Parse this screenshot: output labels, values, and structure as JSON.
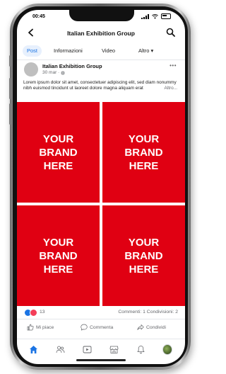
{
  "status_bar": {
    "time": "00:45"
  },
  "header": {
    "title": "Italian Exhibition Group",
    "back_icon": "chevron-left-icon",
    "search_icon": "search-icon"
  },
  "tabs": [
    {
      "label": "Post",
      "active": true
    },
    {
      "label": "Informazioni",
      "active": false
    },
    {
      "label": "Video",
      "active": false
    },
    {
      "label": "Altro ▾",
      "active": false
    }
  ],
  "post": {
    "author": "Italian Exhibition Group",
    "meta": "30 mar ·",
    "text": "Lorem ipsum dolor sit amet, consectetuer adipiscing elit, sed diam nonummy nibh euismod tincidunt ut laoreet dolore magna aliquam erat",
    "more_label": "Altro...",
    "tiles": [
      {
        "label": "YOUR\nBRAND\nHERE"
      },
      {
        "label": "YOUR\nBRAND\nHERE"
      },
      {
        "label": "YOUR\nBRAND\nHERE"
      },
      {
        "label": "YOUR\nBRAND\nHERE"
      }
    ],
    "tile_color": "#e00012",
    "reaction_count": "13",
    "summary": "Commenti: 1  Condivisioni: 2",
    "actions": {
      "like": "Mi piace",
      "comment": "Commenta",
      "share": "Condividi"
    }
  },
  "bottom_nav": [
    "home-icon",
    "friends-icon",
    "video-icon",
    "marketplace-icon",
    "bell-icon",
    "profile-avatar"
  ],
  "colors": {
    "accent": "#1b74e4",
    "brand_red": "#e00012"
  }
}
